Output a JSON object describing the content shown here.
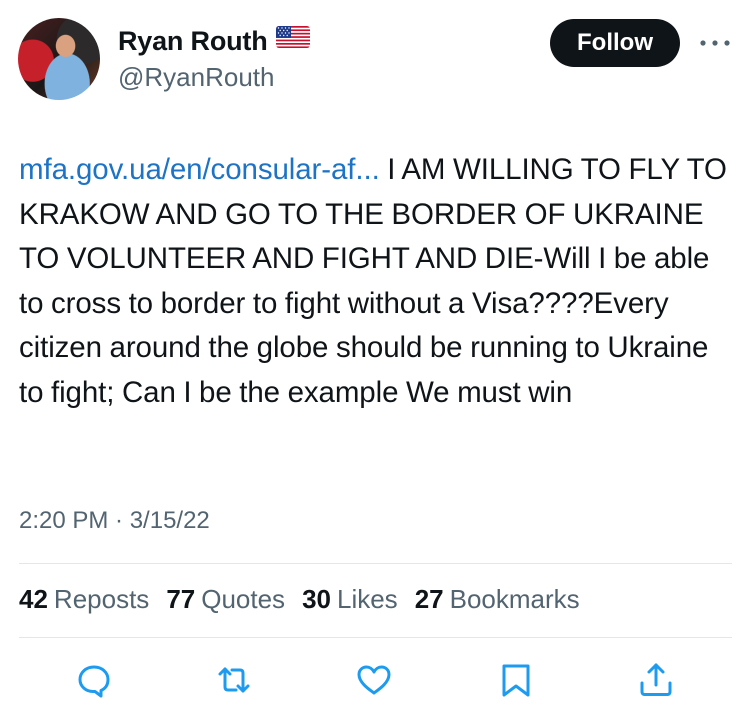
{
  "author": {
    "display_name": "Ryan Routh",
    "handle": "@RyanRouth",
    "flag_icon": "us-flag-icon"
  },
  "follow_button": {
    "label": "Follow"
  },
  "tweet": {
    "link_text": "mfa.gov.ua/en/consular-af...",
    "body": " I AM WILLING TO FLY TO KRAKOW AND GO TO THE BORDER OF UKRAINE TO VOLUNTEER AND FIGHT AND DIE-Will I be able to cross to border to fight without a Visa????Every citizen around the globe should be running to Ukraine to fight; Can I be the example We must win",
    "timestamp": "2:20 PM · 3/15/22"
  },
  "stats": [
    {
      "count": "42",
      "label": "Reposts"
    },
    {
      "count": "77",
      "label": "Quotes"
    },
    {
      "count": "30",
      "label": "Likes"
    },
    {
      "count": "27",
      "label": "Bookmarks"
    }
  ],
  "actions": [
    "reply-icon",
    "repost-icon",
    "like-icon",
    "bookmark-icon",
    "share-icon"
  ],
  "colors": {
    "link": "#1d74c6",
    "text": "#0f1419",
    "secondary": "#536471",
    "icon": "#1d9bf0",
    "button_bg": "#0f1419"
  }
}
